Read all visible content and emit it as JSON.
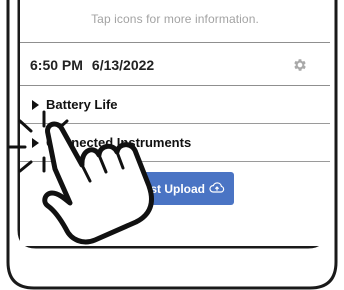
{
  "screen": {
    "hint_text": "Tap icons for more information."
  },
  "status_bar": {
    "time": "6:50 PM",
    "date": "6/13/2022",
    "settings_icon": "gear-icon"
  },
  "sections": [
    {
      "label": "Battery Life",
      "icon": "caret-right-icon"
    },
    {
      "label": "Connected Instruments",
      "icon": "caret-right-icon"
    }
  ],
  "upload_button": {
    "label": "Test Upload",
    "icon": "cloud-upload-icon"
  },
  "colors": {
    "accent": "#4a74c4",
    "hint_text": "#a3a3a3",
    "divider": "#8f8f8f"
  },
  "overlay": {
    "icon": "tap-hand-icon"
  }
}
